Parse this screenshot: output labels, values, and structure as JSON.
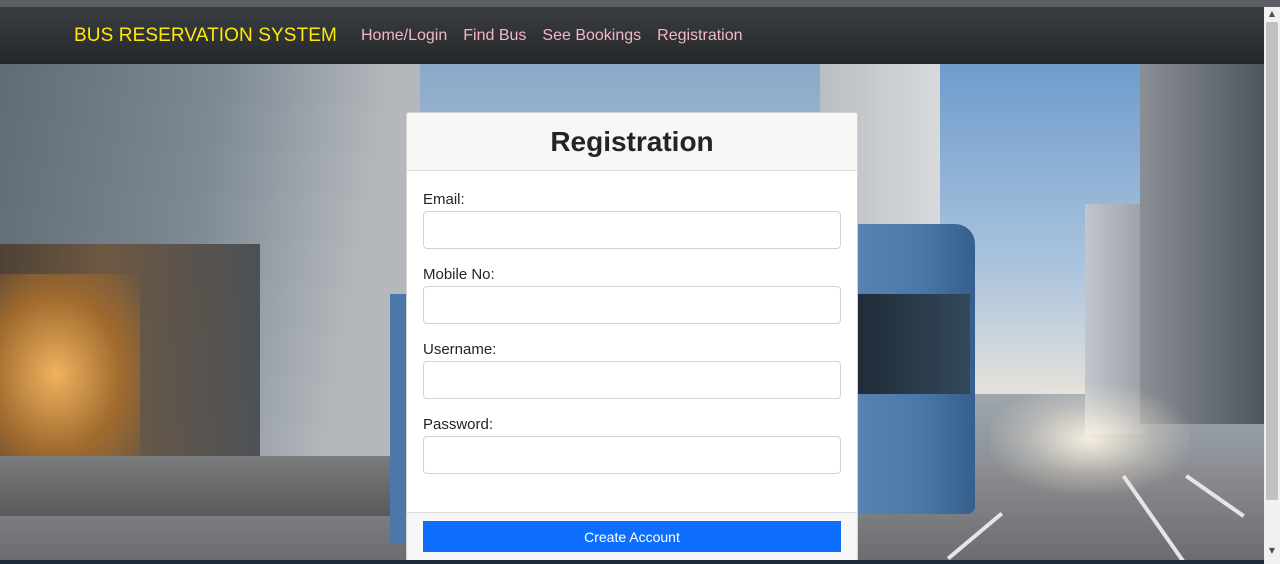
{
  "navbar": {
    "brand": "BUS RESERVATION SYSTEM",
    "links": [
      {
        "label": "Home/Login"
      },
      {
        "label": "Find Bus"
      },
      {
        "label": "See Bookings"
      },
      {
        "label": "Registration"
      }
    ]
  },
  "form": {
    "title": "Registration",
    "fields": [
      {
        "label": "Email:",
        "value": ""
      },
      {
        "label": "Mobile No:",
        "value": ""
      },
      {
        "label": "Username:",
        "value": ""
      },
      {
        "label": "Password:",
        "value": ""
      }
    ],
    "submit_label": "Create Account"
  },
  "colors": {
    "brand": "#ffea00",
    "nav_link": "#f4b6c4",
    "primary_button": "#0d6efd"
  }
}
